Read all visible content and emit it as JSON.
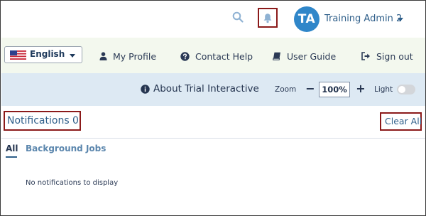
{
  "header": {
    "avatar_initials": "TA",
    "user_name": "Training Admin 2",
    "icons": [
      "search-icon",
      "bell-icon",
      "chevron-down-icon"
    ]
  },
  "nav": {
    "language": "English",
    "items": [
      {
        "label": "My Profile",
        "icon": "user-icon"
      },
      {
        "label": "Contact Help",
        "icon": "help-circle-icon"
      },
      {
        "label": "User Guide",
        "icon": "book-icon"
      },
      {
        "label": "Sign out",
        "icon": "sign-out-icon"
      }
    ]
  },
  "toolbar": {
    "about_label": "About Trial Interactive",
    "zoom_label": "Zoom",
    "zoom_minus": "−",
    "zoom_value": "100%",
    "zoom_plus": "+",
    "theme_label": "Light",
    "light_toggle_on": false
  },
  "notifications": {
    "title": "Notifications",
    "count": "0",
    "clear_all": "Clear All",
    "tabs": [
      {
        "label": "All",
        "active": true
      },
      {
        "label": "Background Jobs",
        "active": false
      }
    ],
    "empty_message": "No notifications to display"
  },
  "colors": {
    "accent_blue": "#2f86c9",
    "highlight_red": "#8b1a1a",
    "nav_bg": "#f3f8ee",
    "toolbar_bg": "#dde9f3"
  }
}
